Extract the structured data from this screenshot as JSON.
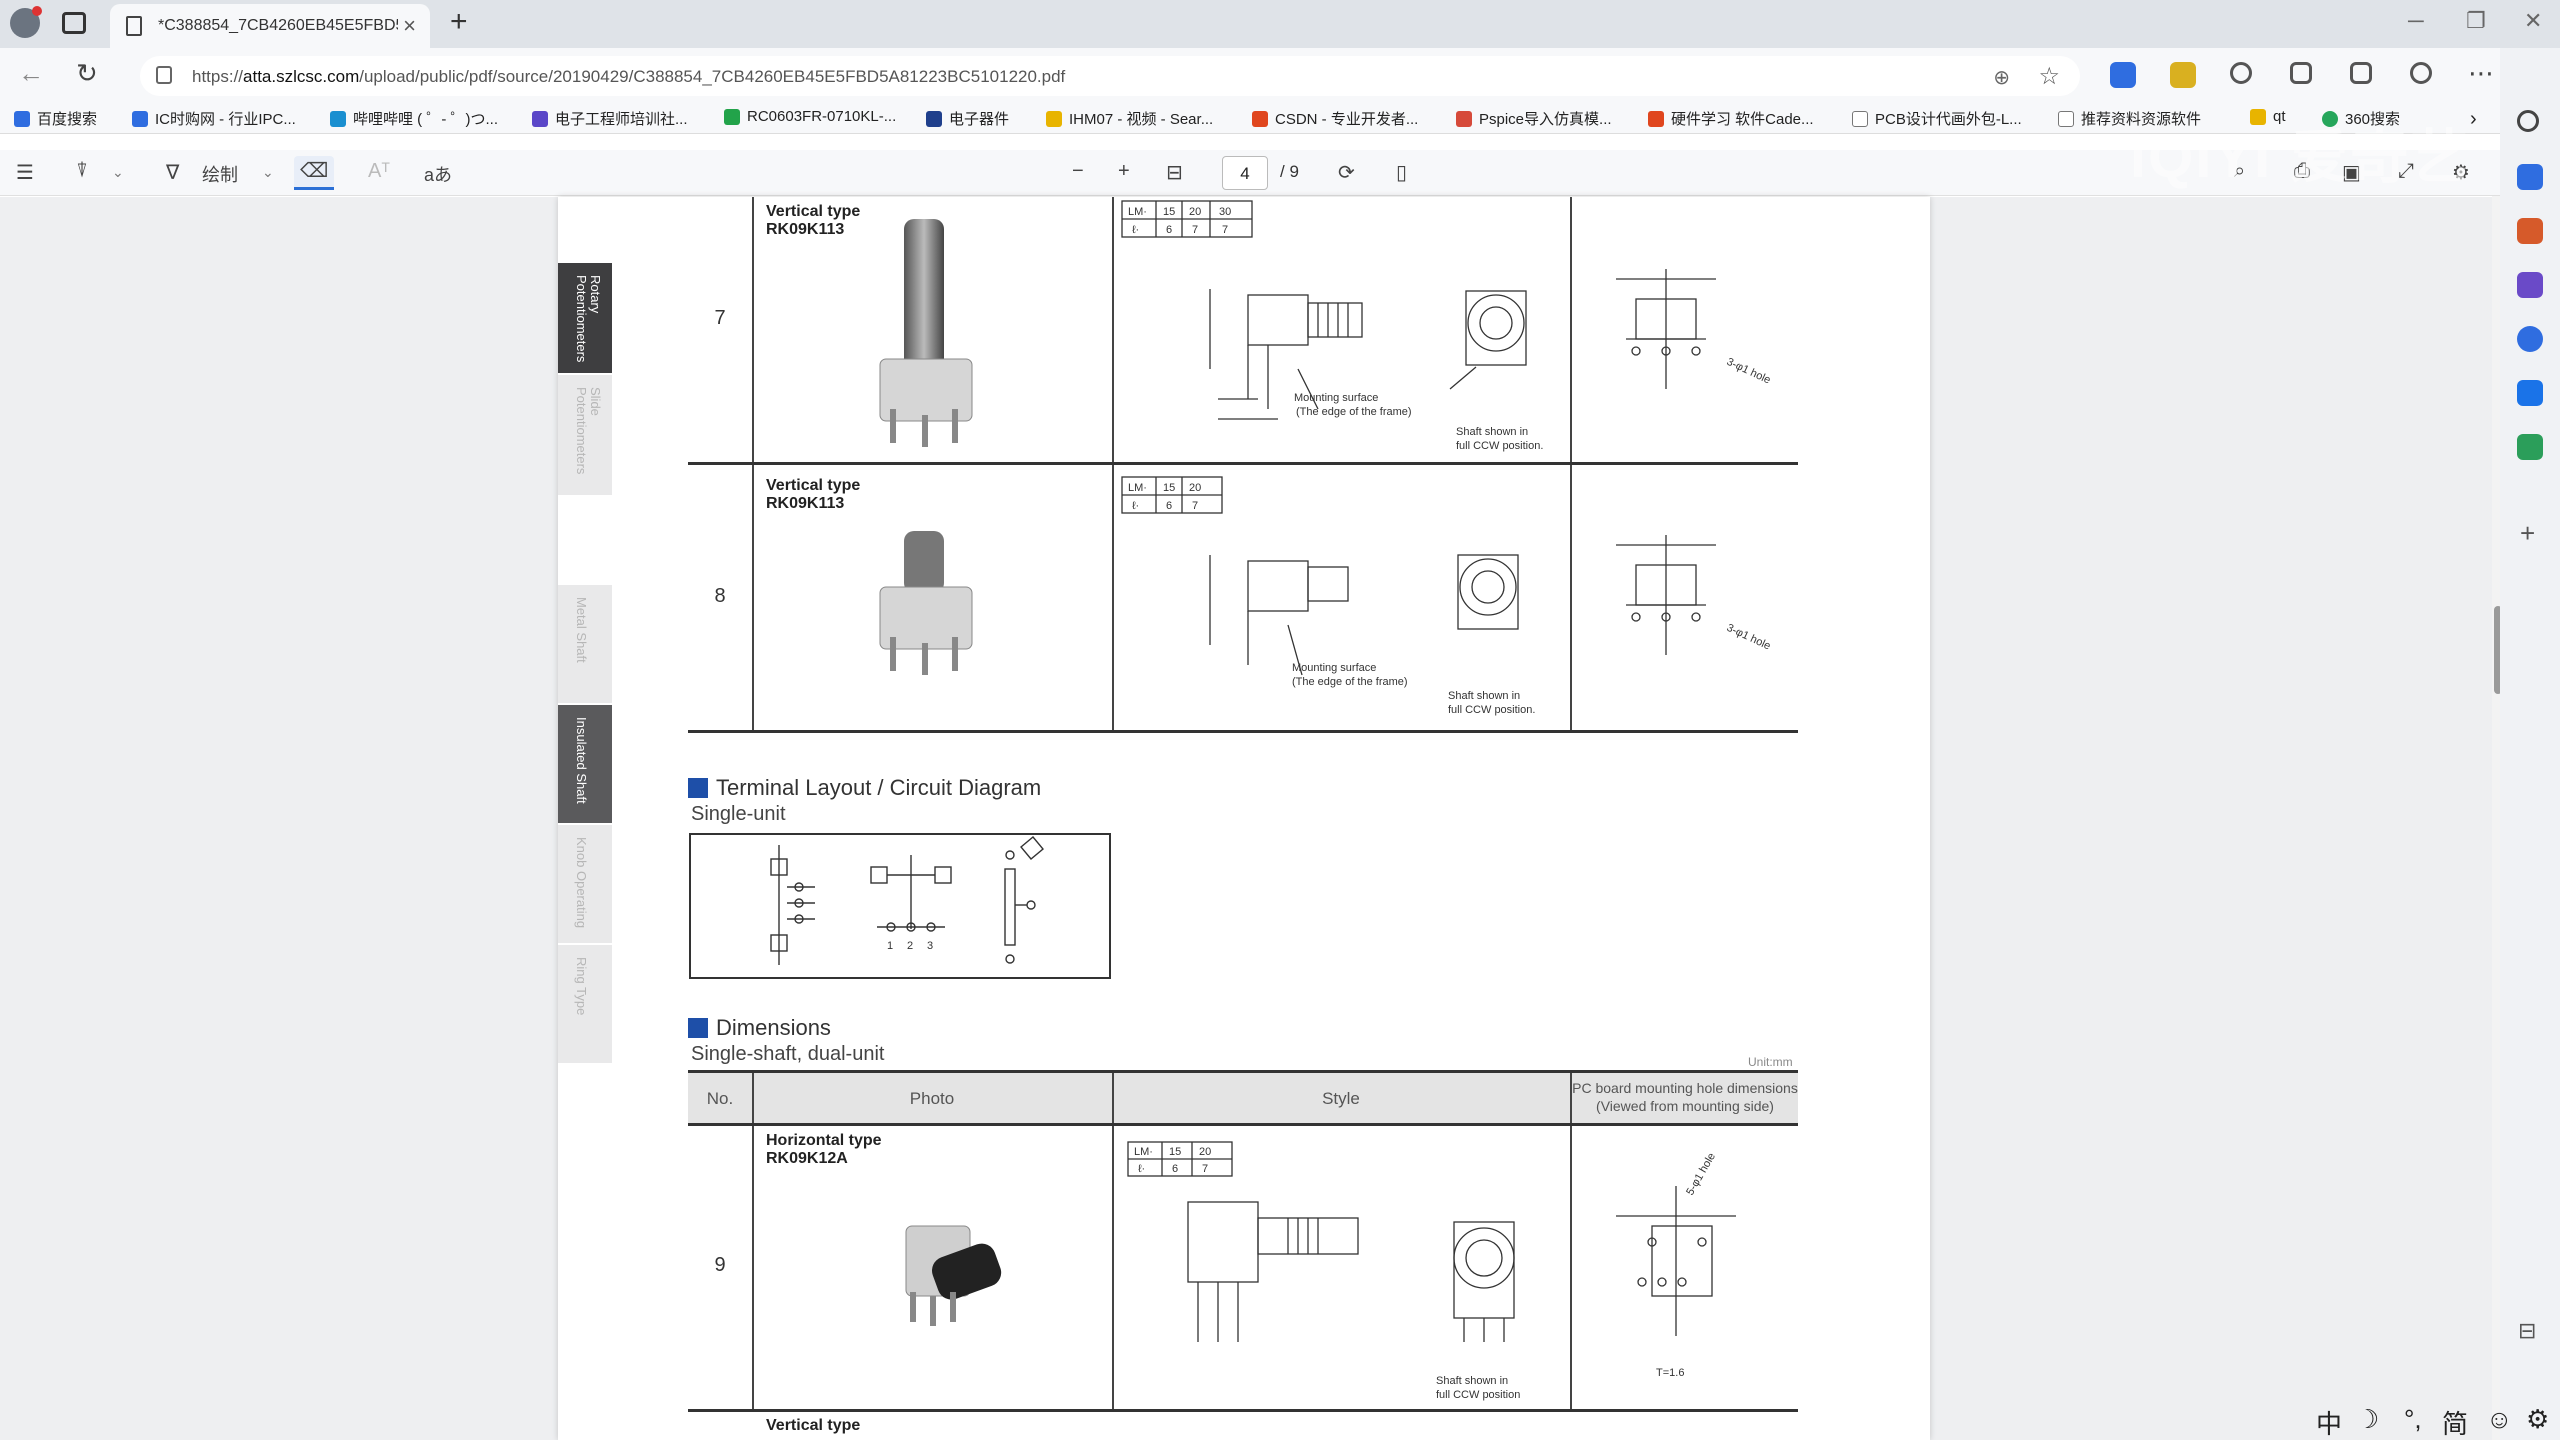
{
  "browser": {
    "tab_title": "*C388854_7CB4260EB45E5FBD5/",
    "url_prefix": "https://",
    "url_domain": "atta.szlcsc.com",
    "url_path": "/upload/public/pdf/source/20190429/C388854_7CB4260EB45E5FBD5A81223BC5101220.pdf",
    "bookmarks": [
      {
        "label": "百度搜索",
        "color": "#2f6de0"
      },
      {
        "label": "IC时购网 - 行业IPC...",
        "color": "#2f6de0"
      },
      {
        "label": "哔哩哔哩 ( ゜- ゜)つ...",
        "color": "#1a8fd0"
      },
      {
        "label": "电子工程师培训社...",
        "color": "#5a46c8"
      },
      {
        "label": "RC0603FR-0710KL-...",
        "color": "#22a34a"
      },
      {
        "label": "电子器件",
        "color": "#1f3f8c"
      },
      {
        "label": "IHM07 - 视频 - Sear...",
        "color": "#e8b400"
      },
      {
        "label": "CSDN - 专业开发者...",
        "color": "#e0461e"
      },
      {
        "label": "Pspice导入仿真模...",
        "color": "#d64a3a"
      },
      {
        "label": "硬件学习 软件Cade...",
        "color": "#e0461e"
      },
      {
        "label": "PCB设计代画外包-L...",
        "color": "#777777"
      },
      {
        "label": "推荐资料资源软件",
        "color": "#777777"
      },
      {
        "label": "qt",
        "color": "#e8b400"
      },
      {
        "label": "360搜索",
        "color": "#26a65b"
      }
    ]
  },
  "pdf_toolbar": {
    "draw_label": "绘制",
    "read_aloud_label": "aあ",
    "current_page": "4",
    "total_pages": "/ 9"
  },
  "watermark": "iQIYI 爱奇艺",
  "side_tabs": [
    {
      "label": "Rotary Potentiometers",
      "active": true
    },
    {
      "label": "Slide Potentiometers",
      "active": false
    },
    {
      "label": "Metal Shaft",
      "active": false
    },
    {
      "label": "Insulated Shaft",
      "active": true
    },
    {
      "label": "Knob Operating",
      "active": false
    },
    {
      "label": "Ring Type",
      "active": false
    }
  ],
  "rows": [
    {
      "no": "7",
      "model_type": "Vertical type",
      "model_code": "RK09K113",
      "lm_header": [
        "LM·",
        "15",
        "20",
        "30"
      ],
      "l_row": [
        "ℓ·",
        "6",
        "7",
        "7"
      ],
      "labels": {
        "mount": "Mounting surface",
        "mount2": "(The edge of the frame)",
        "shaft": "Shaft shown in",
        "shaft2": "full CCW position.",
        "hole": "3-φ1 hole"
      }
    },
    {
      "no": "8",
      "model_type": "Vertical type",
      "model_code": "RK09K113",
      "lm_header": [
        "LM·",
        "15",
        "20"
      ],
      "l_row": [
        "ℓ·",
        "6",
        "7"
      ],
      "labels": {
        "mount": "Mounting surface",
        "mount2": "(The edge of the frame)",
        "shaft": "Shaft shown in",
        "shaft2": "full CCW position.",
        "hole": "3-φ1 hole"
      }
    }
  ],
  "terminal": {
    "title": "Terminal Layout / Circuit Diagram",
    "subtitle": "Single-unit",
    "pins": [
      "1",
      "2",
      "3"
    ]
  },
  "dimensions": {
    "title": "Dimensions",
    "subtitle": "Single-shaft, dual-unit",
    "unit_note": "Unit:mm",
    "headers": {
      "no": "No.",
      "photo": "Photo",
      "style": "Style",
      "pcb1": "PC board mounting hole dimensions",
      "pcb2": "(Viewed from mounting side)"
    },
    "row": {
      "no": "9",
      "model_type": "Horizontal type",
      "model_code": "RK09K12A",
      "lm_header": [
        "LM·",
        "15",
        "20"
      ],
      "l_row": [
        "ℓ·",
        "6",
        "7"
      ],
      "shaft": "Shaft shown in",
      "shaft2": "full CCW position",
      "thickness": "T=1.6",
      "hole": "5-φ1 hole"
    },
    "next_row_label": "Vertical type"
  },
  "ime": {
    "lang": "中",
    "moon": "☽",
    "punct": "°,",
    "simp": "简",
    "emoji": "☺",
    "gear": "⚙"
  }
}
